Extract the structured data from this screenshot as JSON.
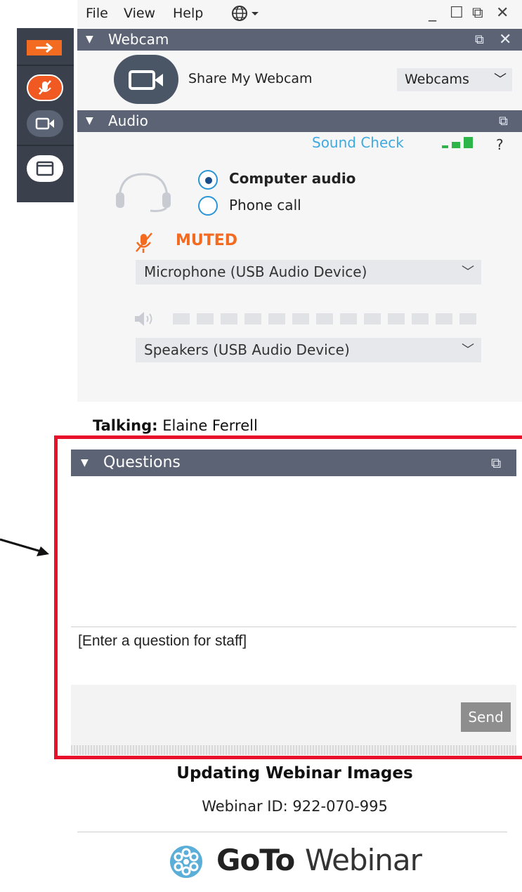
{
  "menu": {
    "items": [
      "File",
      "View",
      "Help"
    ],
    "window_controls": [
      "_",
      "☐",
      "⧉",
      "✕"
    ]
  },
  "webcam": {
    "header": "Webcam",
    "share_label": "Share My Webcam",
    "device_dropdown": "Webcams"
  },
  "audio": {
    "header": "Audio",
    "sound_check": "Sound Check",
    "help": "?",
    "options": [
      {
        "label": "Computer audio",
        "selected": true
      },
      {
        "label": "Phone call",
        "selected": false
      }
    ],
    "mute_status": "MUTED",
    "microphone": "Microphone (USB Audio Device)",
    "speakers": "Speakers (USB Audio Device)",
    "speaker_level": 0
  },
  "talking": {
    "label": "Talking:",
    "name": "Elaine Ferrell"
  },
  "questions": {
    "header": "Questions",
    "input_placeholder": "[Enter a question for staff]",
    "send_label": "Send"
  },
  "webinar": {
    "title": "Updating Webinar Images",
    "id_text": "Webinar ID: 922-070-995"
  },
  "logo": {
    "goto": "GoTo",
    "webinar": "Webinar"
  },
  "colors": {
    "accent_orange": "#f26b21",
    "header_gray": "#5b6375",
    "highlight_red": "#e8102a",
    "signal_green": "#2eb54a",
    "link_blue": "#3fa9e0"
  }
}
